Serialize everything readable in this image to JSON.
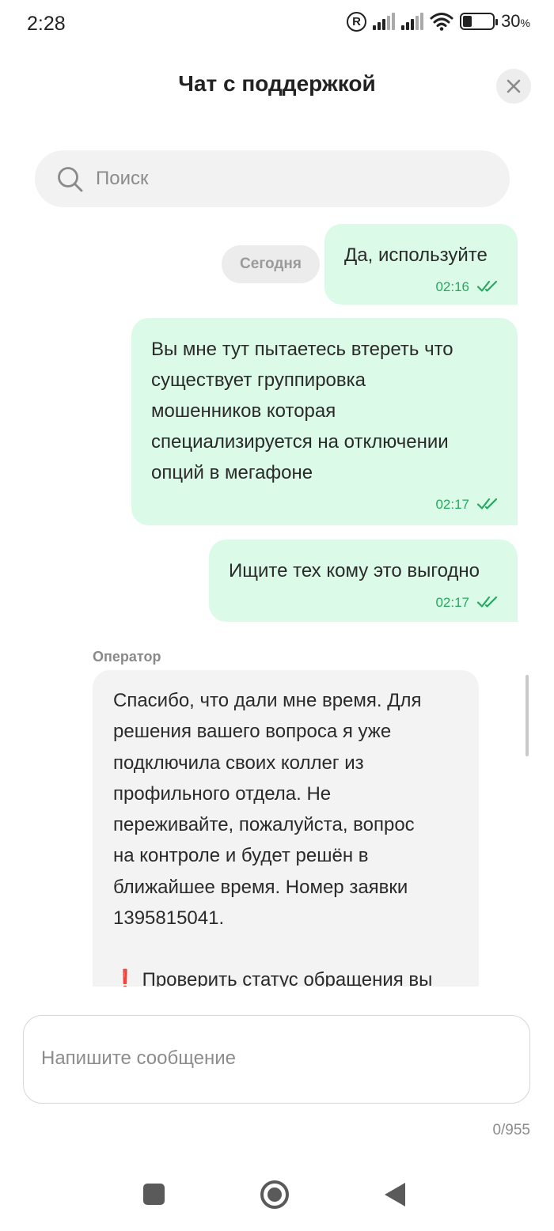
{
  "status_bar": {
    "time": "2:28",
    "registered_mark": "R",
    "battery_percent": "30",
    "battery_percent_sign": "%",
    "battery_level": 0.3
  },
  "header": {
    "title": "Чат с поддержкой",
    "close_icon": "close-icon"
  },
  "search": {
    "placeholder": "Поиск",
    "icon": "search-icon"
  },
  "chat": {
    "date_separator": "Сегодня",
    "messages_out": [
      {
        "text": "Да, используйте",
        "time": "02:16",
        "status_icon": "double-check-icon"
      },
      {
        "text": "Вы мне тут пытаетесь втереть что\nсуществует группировка\nмошенников которая\nспециализируется на отключении\nопций в мегафоне",
        "time": "02:17",
        "status_icon": "double-check-icon"
      },
      {
        "text": "Ищите тех кому это выгодно",
        "time": "02:17",
        "status_icon": "double-check-icon"
      }
    ],
    "incoming": {
      "sender": "Оператор",
      "paragraph_1": "Спасибо, что дали мне время. Для\nрешения вашего вопроса я уже\nподключила своих коллег из\nпрофильного отдела. Не\nпереживайте, пожалуйста, вопрос\nна контроле и будет решён в\nближайшее время. Номер заявки\n1395815041.",
      "alert_mark": "❗",
      "paragraph_2": "Проверить статус обращения вы"
    }
  },
  "composer": {
    "placeholder": "Напишите сообщение",
    "counter": "0/955"
  },
  "colors": {
    "outgoing_bubble": "#dbfbe8",
    "incoming_bubble": "#f3f3f3",
    "accent_green": "#27a862"
  }
}
